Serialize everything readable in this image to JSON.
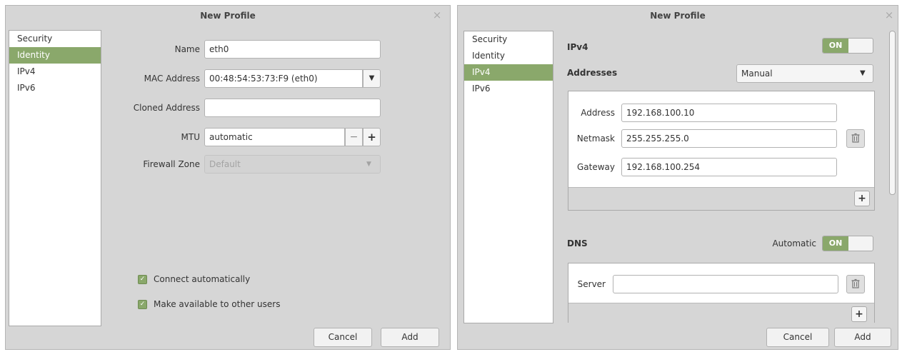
{
  "left_dialog": {
    "title": "New Profile",
    "close_glyph": "×",
    "sidebar": [
      {
        "label": "Security"
      },
      {
        "label": "Identity"
      },
      {
        "label": "IPv4"
      },
      {
        "label": "IPv6"
      }
    ],
    "active_index": 1,
    "fields": {
      "name_label": "Name",
      "name_value": "eth0",
      "mac_label": "MAC Address",
      "mac_value": "00:48:54:53:73:F9 (eth0)",
      "cloned_label": "Cloned Address",
      "cloned_value": "",
      "mtu_label": "MTU",
      "mtu_value": "automatic",
      "minus": "−",
      "plus": "+",
      "firewall_label": "Firewall Zone",
      "firewall_value": "Default"
    },
    "checks": {
      "connect_auto": "Connect automatically",
      "available_users": "Make available to other users"
    },
    "buttons": {
      "cancel": "Cancel",
      "add": "Add"
    }
  },
  "right_dialog": {
    "title": "New Profile",
    "close_glyph": "×",
    "sidebar": [
      {
        "label": "Security"
      },
      {
        "label": "Identity"
      },
      {
        "label": "IPv4"
      },
      {
        "label": "IPv6"
      }
    ],
    "active_index": 2,
    "ipv4_heading": "IPv4",
    "ipv4_toggle": "ON",
    "addresses_label": "Addresses",
    "addresses_method": "Manual",
    "address_label": "Address",
    "address_value": "192.168.100.10",
    "netmask_label": "Netmask",
    "netmask_value": "255.255.255.0",
    "gateway_label": "Gateway",
    "gateway_value": "192.168.100.254",
    "add_glyph": "+",
    "dns_heading": "DNS",
    "dns_auto_label": "Automatic",
    "dns_toggle": "ON",
    "server_label": "Server",
    "server_value": "",
    "buttons": {
      "cancel": "Cancel",
      "add": "Add"
    }
  },
  "colors": {
    "accent": "#8aa86b",
    "window_bg": "#d6d6d6"
  },
  "icons": [
    "close-icon",
    "dropdown-arrow-icon",
    "minus-icon",
    "plus-icon",
    "check-icon",
    "trash-icon"
  ]
}
